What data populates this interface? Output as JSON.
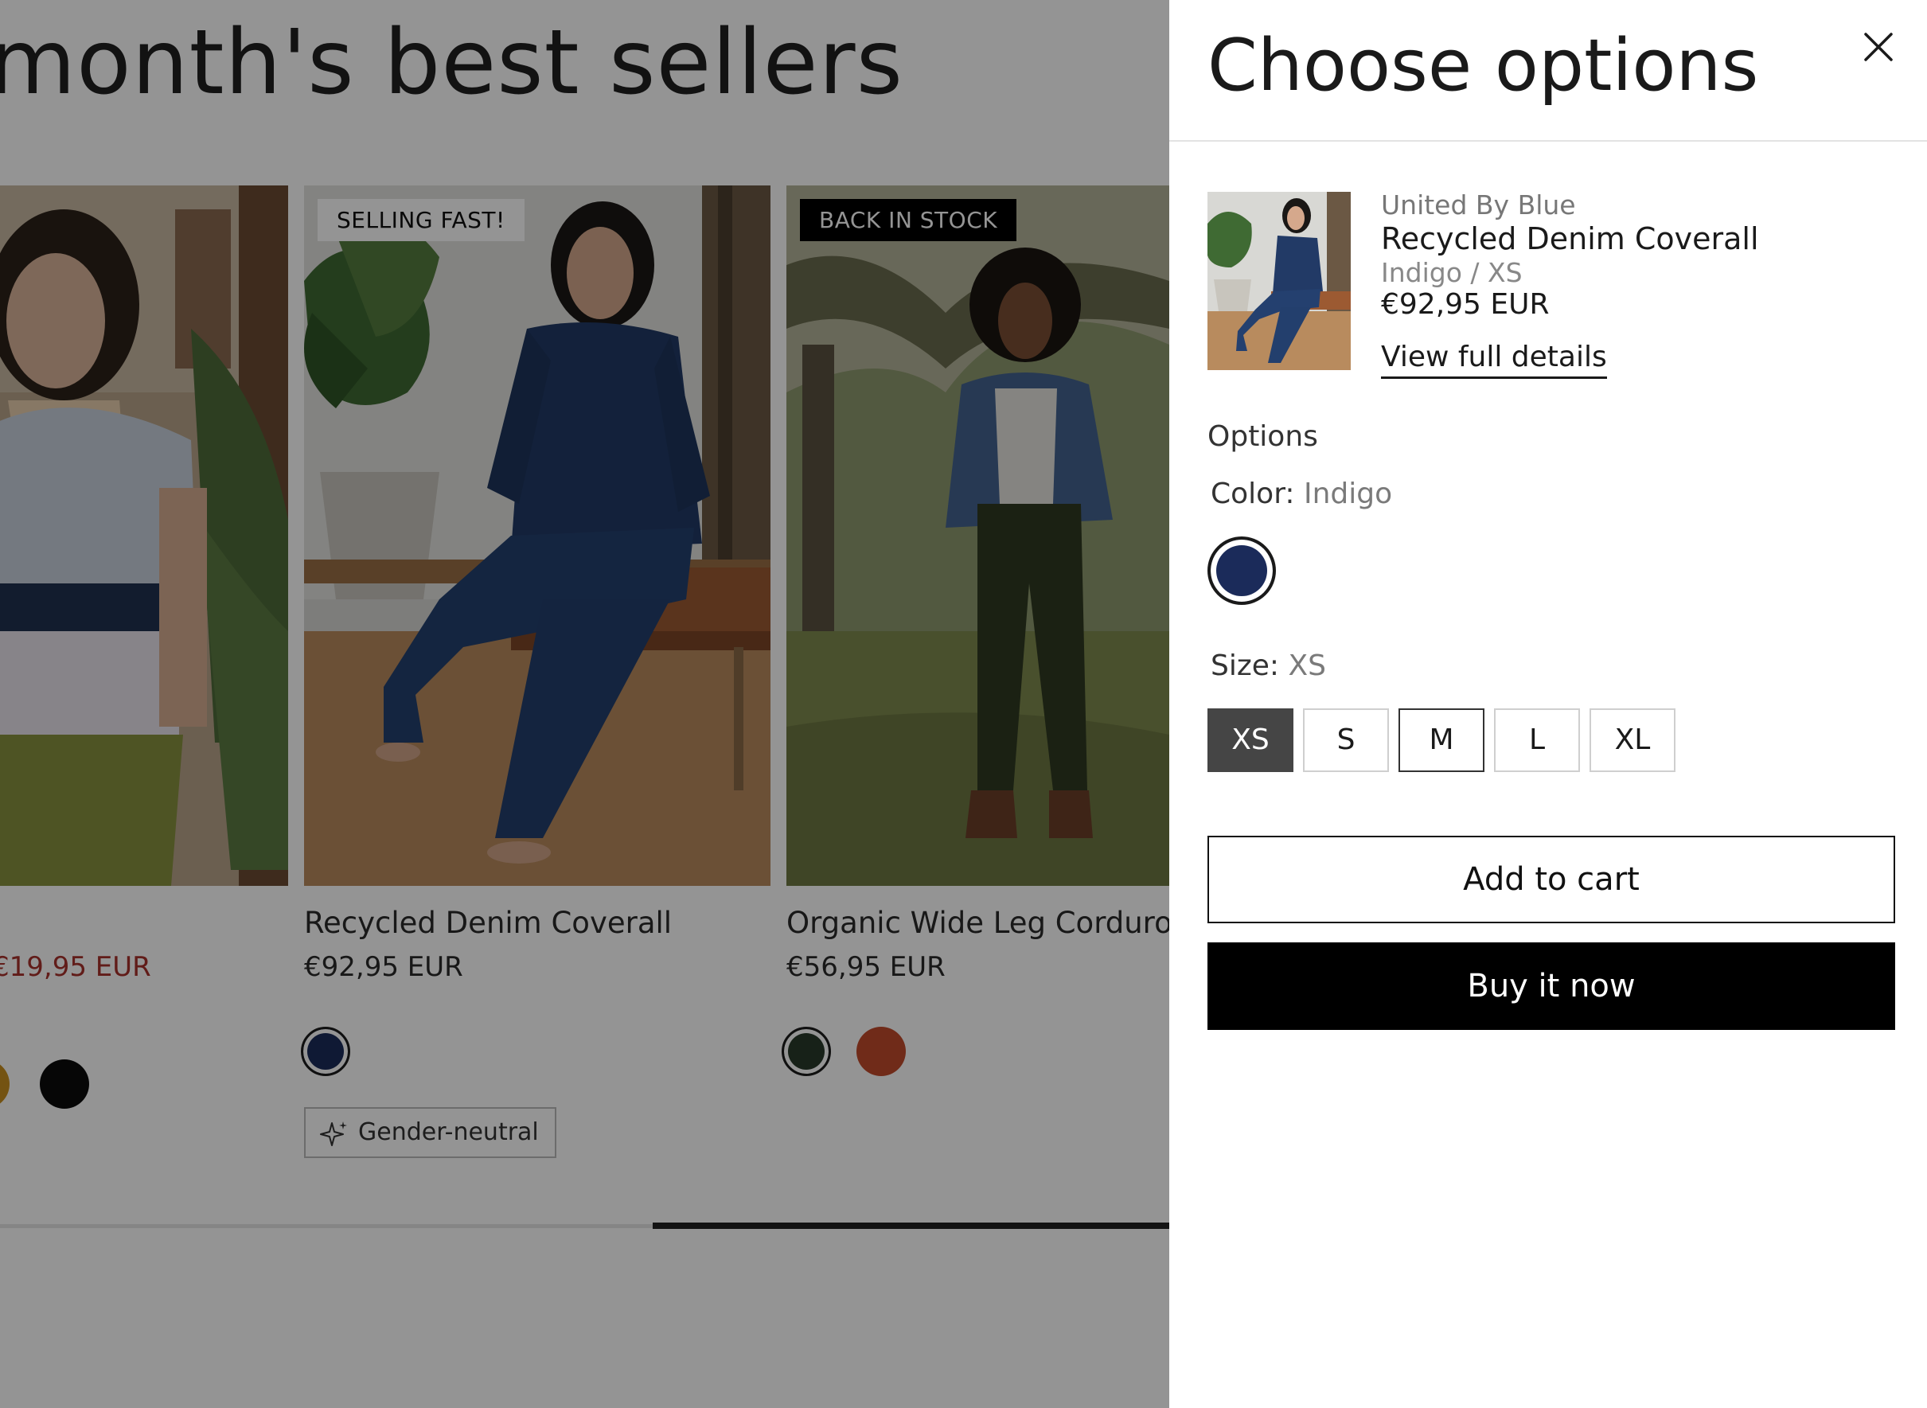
{
  "page": {
    "heading": "month's best sellers",
    "products": [
      {
        "price": "€19,95 EUR",
        "swatches": [
          {
            "name": "mustard",
            "color": "#c98f1f"
          },
          {
            "name": "black",
            "color": "#0c0c0c"
          }
        ]
      },
      {
        "badge": "SELLING FAST!",
        "title": "Recycled Denim Coverall",
        "price": "€92,95 EUR",
        "swatches": [
          {
            "name": "indigo",
            "color": "#1b2b5a"
          }
        ],
        "tag": "Gender-neutral"
      },
      {
        "badge": "BACK IN STOCK",
        "title": "Organic Wide Leg Corduroy",
        "price": "€56,95 EUR",
        "swatches": [
          {
            "name": "dark-green",
            "color": "#283a2a"
          },
          {
            "name": "rust",
            "color": "#c24a2b"
          }
        ]
      }
    ]
  },
  "drawer": {
    "title": "Choose options",
    "close_icon": "close-icon",
    "product": {
      "vendor": "United By Blue",
      "name": "Recycled Denim Coverall",
      "variant": "Indigo / XS",
      "price": "€92,95 EUR",
      "details_link": "View full details"
    },
    "options_label": "Options",
    "color": {
      "label": "Color:",
      "value": "Indigo",
      "swatch": "#1b2b5a"
    },
    "size": {
      "label": "Size:",
      "value": "XS",
      "options": [
        "XS",
        "S",
        "M",
        "L",
        "XL"
      ],
      "selected": "XS"
    },
    "add_to_cart": "Add to cart",
    "buy_now": "Buy it now"
  },
  "colors": {
    "overlay": "rgba(0,0,0,0.42)",
    "sale_price": "#a8312b",
    "active_size": "#454545"
  }
}
